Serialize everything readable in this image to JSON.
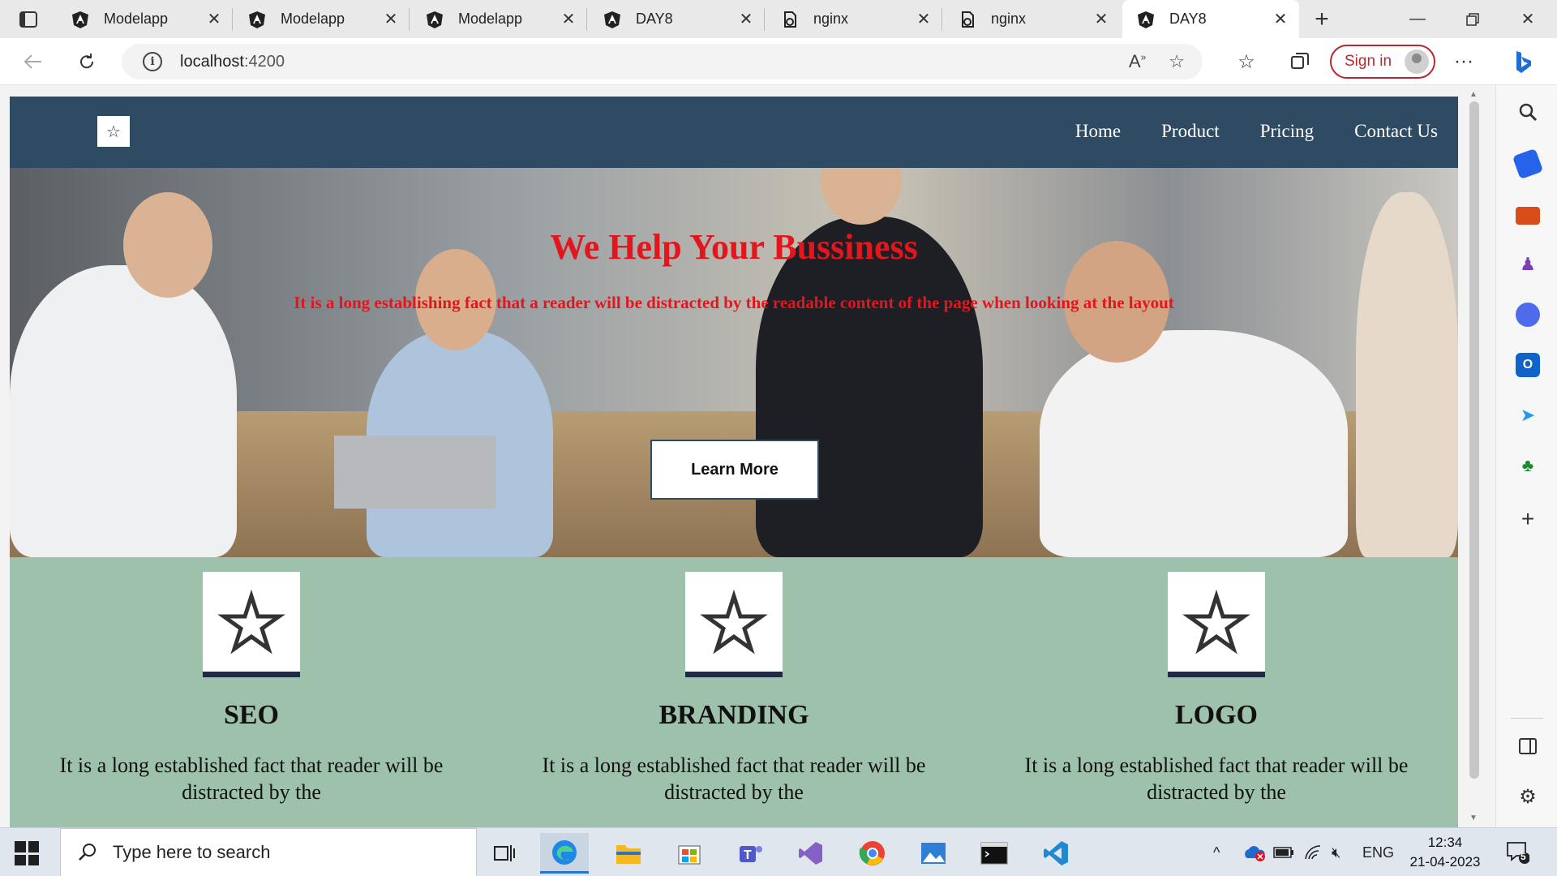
{
  "browser": {
    "tabs": [
      {
        "title": "Modelapp",
        "favicon": "angular-icon"
      },
      {
        "title": "Modelapp",
        "favicon": "angular-icon"
      },
      {
        "title": "Modelapp",
        "favicon": "angular-icon"
      },
      {
        "title": "DAY8",
        "favicon": "angular-icon"
      },
      {
        "title": "nginx",
        "favicon": "page-icon"
      },
      {
        "title": "nginx",
        "favicon": "page-icon"
      },
      {
        "title": "DAY8",
        "favicon": "angular-icon",
        "active": true
      }
    ],
    "url_host": "localhost",
    "url_port": ":4200",
    "sign_in": "Sign in",
    "accent": "#b8282f"
  },
  "site": {
    "nav": [
      "Home",
      "Product",
      "Pricing",
      "Contact Us"
    ],
    "nav_color": "#2f4b63",
    "hero": {
      "title": "We Help Your Bussiness",
      "subtitle": "It is a long establishing fact that a reader will be distracted by the readable content of the page when looking at the layout",
      "button": "Learn More",
      "text_color": "#e3161d"
    },
    "services": [
      {
        "title": "SEO",
        "text": "It is a long established fact that reader will be distracted by the"
      },
      {
        "title": "BRANDING",
        "text": "It is a long established fact that reader will be distracted by the"
      },
      {
        "title": "LOGO",
        "text": "It is a long established fact that reader will be distracted by the"
      }
    ],
    "services_bg": "#9dc1ab"
  },
  "taskbar": {
    "search_placeholder": "Type here to search",
    "language": "ENG",
    "time": "12:34",
    "date": "21-04-2023",
    "notification_count": "5"
  }
}
